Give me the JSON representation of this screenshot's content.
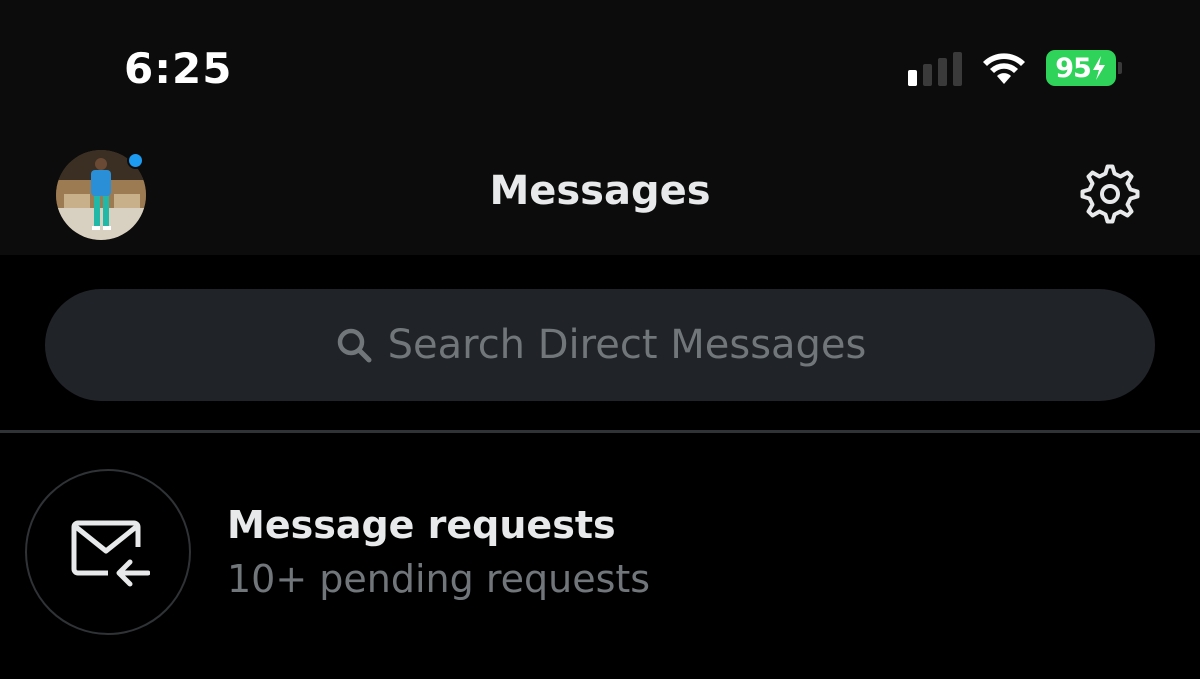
{
  "status_bar": {
    "time": "6:25",
    "battery_level": "95",
    "battery_color": "#2fd35a",
    "icons": [
      "cellular-signal-icon",
      "wifi-icon",
      "battery-charging-icon"
    ]
  },
  "header": {
    "title": "Messages",
    "avatar": "user-avatar",
    "avatar_badge_color": "#1d9bf0",
    "settings_icon": "gear-icon"
  },
  "search": {
    "placeholder": "Search Direct Messages",
    "icon": "search-icon"
  },
  "message_requests": {
    "icon": "envelope-arrow-icon",
    "title": "Message requests",
    "subtitle": "10+ pending requests"
  },
  "colors": {
    "background": "#000000",
    "header_bg": "#0c0c0c",
    "accent": "#1d9bf0",
    "muted_text": "#71767b",
    "search_bg": "#202327"
  }
}
